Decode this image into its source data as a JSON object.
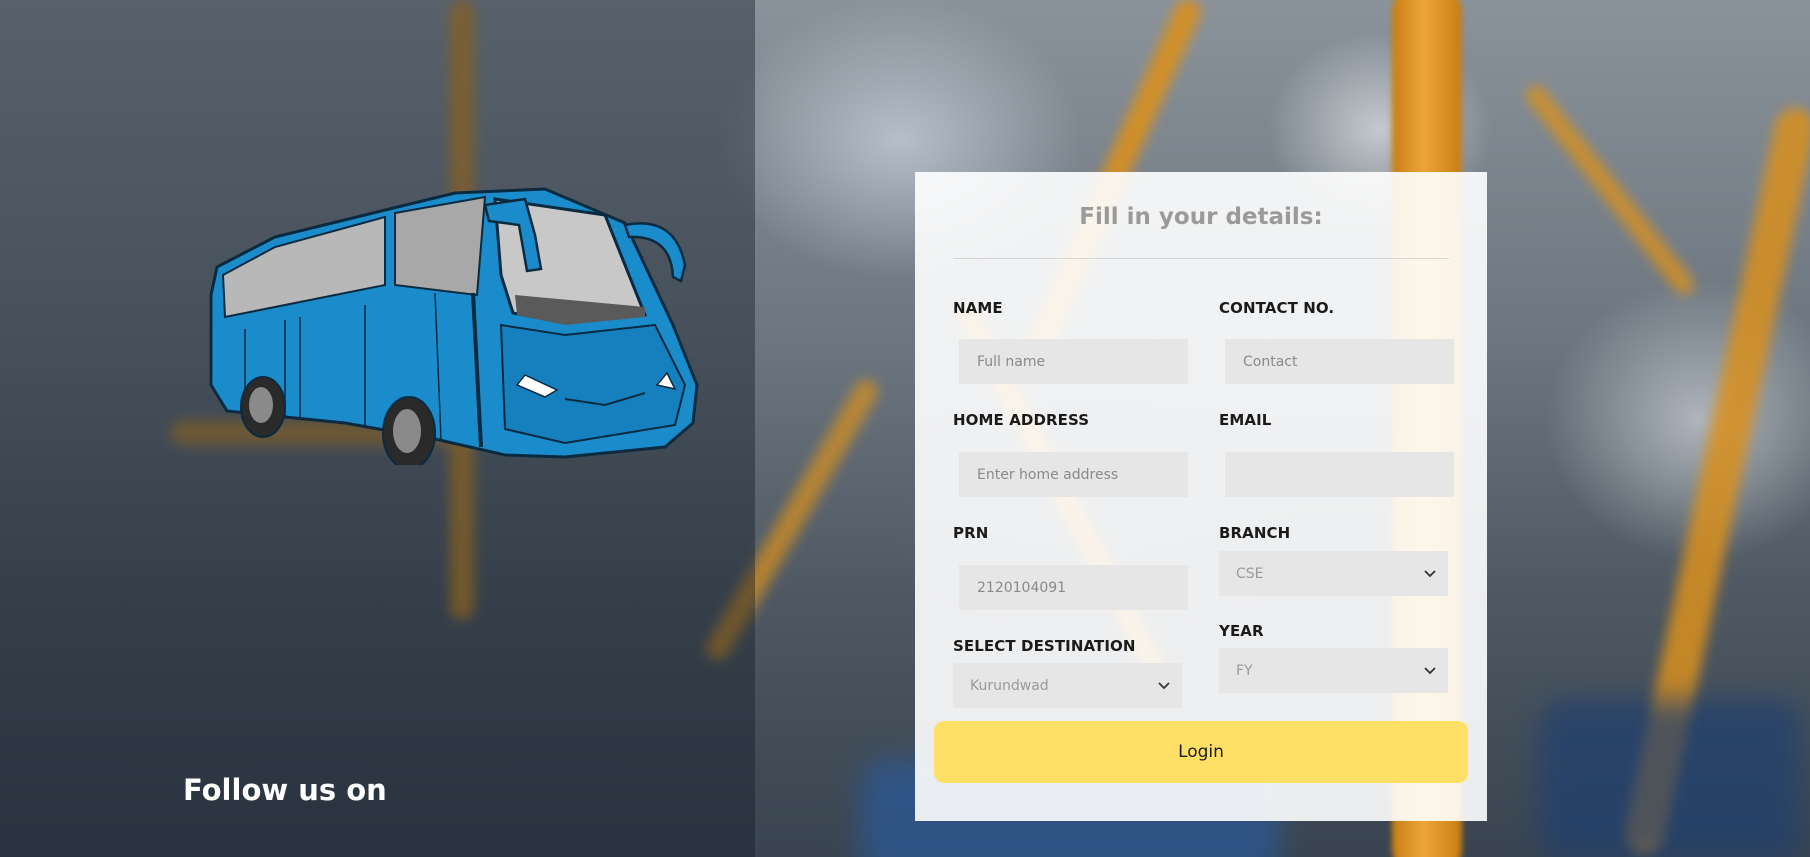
{
  "follow": {
    "text": "Follow us on"
  },
  "form": {
    "title": "Fill in your details:",
    "name": {
      "label": "NAME",
      "placeholder": "Full name",
      "value": ""
    },
    "contact": {
      "label": "CONTACT NO.",
      "placeholder": "Contact",
      "value": ""
    },
    "address": {
      "label": "HOME ADDRESS",
      "placeholder": "Enter home address",
      "value": ""
    },
    "email": {
      "label": "EMAIL",
      "placeholder": "",
      "value": ""
    },
    "prn": {
      "label": "PRN",
      "placeholder": "2120104091",
      "value": ""
    },
    "branch": {
      "label": "BRANCH",
      "selected": "CSE"
    },
    "destination": {
      "label": "SELECT DESTINATION",
      "selected": "Kurundwad"
    },
    "year": {
      "label": "YEAR",
      "selected": "FY"
    },
    "login_label": "Login"
  },
  "colors": {
    "login_button": "#ffe066",
    "input_background": "#e6e6e6",
    "bus_body": "#1a8ccc"
  },
  "icons": {
    "bus": "bus-illustration",
    "select_chevron": "chevron-down-icon"
  }
}
